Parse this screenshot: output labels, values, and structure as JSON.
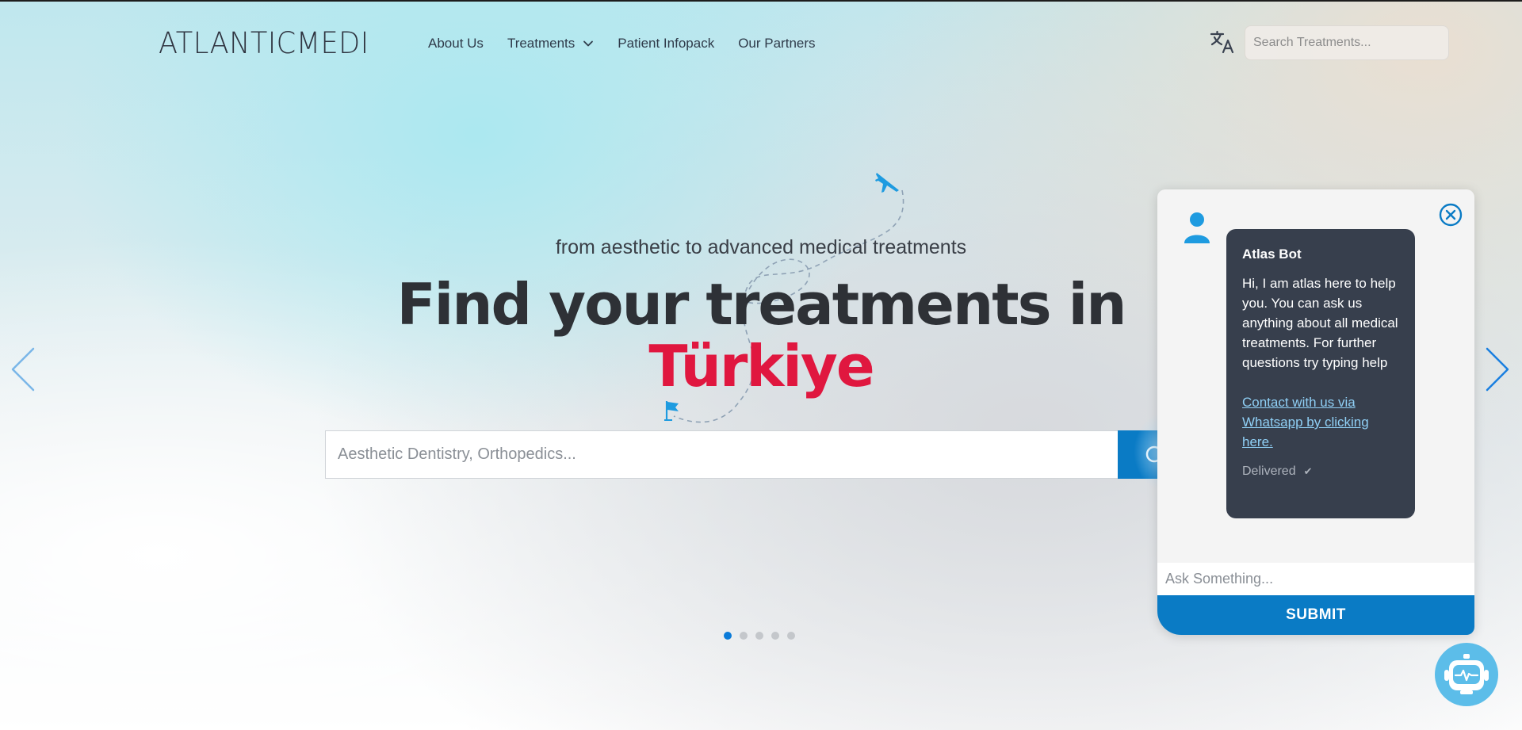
{
  "header": {
    "logo": "ATLANTICMEDI",
    "nav": [
      {
        "label": "About Us"
      },
      {
        "label": "Treatments"
      },
      {
        "label": "Patient Infopack"
      },
      {
        "label": "Our Partners"
      }
    ],
    "search_placeholder": "Search Treatments..."
  },
  "hero": {
    "subtitle": "from aesthetic to advanced medical treatments",
    "title_line1": "Find your treatments in",
    "title_line2": "Türkiye",
    "search_placeholder": "Aesthetic Dentistry, Orthopedics...",
    "slides_total": 5,
    "active_slide": 1
  },
  "chat": {
    "bot_name": "Atlas Bot",
    "message": "Hi, I am atlas here to help you. You can ask us anything about all medical treatments. For further questions try typing help",
    "whatsapp_link": "Contact with us via Whatsapp by clicking here.",
    "status": "Delivered",
    "status_check": "✔",
    "input_placeholder": "Ask Something...",
    "submit_label": "SUBMIT"
  },
  "colors": {
    "accent": "#0a7bc5",
    "title_highlight": "#e0173f",
    "bubble_bg": "#373f4d",
    "link": "#8fcff5"
  },
  "icons": {
    "translate": "translate-icon",
    "chevron": "chevron-down-icon",
    "search": "search-icon",
    "close": "close-circle-icon",
    "user": "user-icon",
    "bot": "robot-icon",
    "plane": "airplane-icon",
    "flag": "flag-icon"
  }
}
